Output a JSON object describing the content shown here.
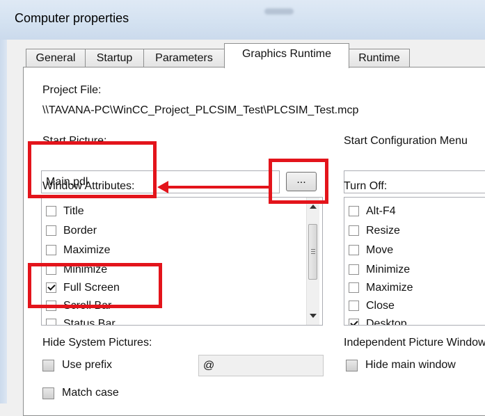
{
  "window": {
    "title": "Computer properties"
  },
  "tabs": [
    {
      "label": "General"
    },
    {
      "label": "Startup"
    },
    {
      "label": "Parameters"
    },
    {
      "label": "Graphics Runtime"
    },
    {
      "label": "Runtime"
    }
  ],
  "project_file": {
    "label": "Project File:",
    "value": "\\\\TAVANA-PC\\WinCC_Project_PLCSIM_Test\\PLCSIM_Test.mcp"
  },
  "start_picture": {
    "label": "Start Picture:",
    "value": "Main.pdl",
    "browse_label": "..."
  },
  "start_config_menu": {
    "label": "Start Configuration Menu",
    "value": ""
  },
  "window_attributes": {
    "label": "Window Attributes:",
    "items": [
      {
        "label": "Title",
        "checked": false
      },
      {
        "label": "Border",
        "checked": false
      },
      {
        "label": "Maximize",
        "checked": false
      },
      {
        "label": "Minimize",
        "checked": false
      },
      {
        "label": "Full Screen",
        "checked": true
      },
      {
        "label": "Scroll Bar",
        "checked": false
      },
      {
        "label": "Status Bar",
        "checked": false
      }
    ]
  },
  "turn_off": {
    "label": "Turn Off:",
    "items": [
      {
        "label": "Alt-F4",
        "checked": false
      },
      {
        "label": "Resize",
        "checked": false
      },
      {
        "label": "Move",
        "checked": false
      },
      {
        "label": "Minimize",
        "checked": false
      },
      {
        "label": "Maximize",
        "checked": false
      },
      {
        "label": "Close",
        "checked": false
      },
      {
        "label": "Desktop",
        "checked": true
      }
    ]
  },
  "hide_system_pictures": {
    "label": "Hide System Pictures:",
    "use_prefix_label": "Use prefix",
    "prefix_value": "@",
    "match_case_label": "Match case"
  },
  "independent_picture": {
    "label": "Independent Picture Window",
    "hide_main_label": "Hide main window"
  },
  "annotation_color": "#e3141b"
}
